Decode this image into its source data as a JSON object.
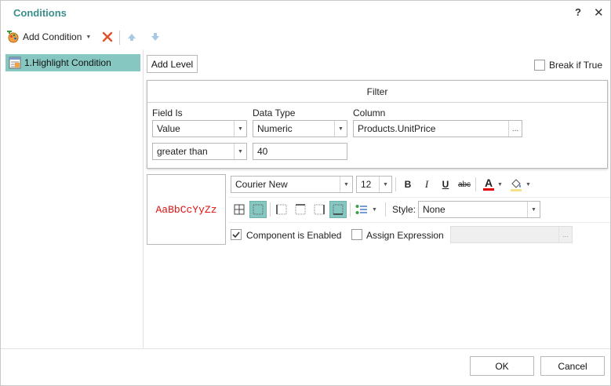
{
  "dialog": {
    "title": "Conditions",
    "help_label": "?",
    "close_label": "✕"
  },
  "toolbar": {
    "add_condition_label": "Add Condition"
  },
  "conditions": [
    {
      "label": "1.Highlight Condition"
    }
  ],
  "panel": {
    "add_level_label": "Add Level",
    "break_if_true_label": "Break if True",
    "break_if_true_checked": false
  },
  "filter": {
    "header": "Filter",
    "field_is_label": "Field Is",
    "data_type_label": "Data Type",
    "column_label": "Column",
    "field_is_value": "Value",
    "data_type_value": "Numeric",
    "column_value": "Products.UnitPrice",
    "browse_label": "...",
    "operator_value": "greater than",
    "operand_value": "40"
  },
  "format": {
    "preview_text": "AaBbCcYyZz",
    "preview_color": "#d11111",
    "font_name": "Courier New",
    "font_size": "12",
    "bold_label": "B",
    "italic_label": "I",
    "underline_label": "U",
    "strike_label": "abc",
    "font_color_label": "A",
    "font_color": "#e00000",
    "style_label": "Style:",
    "style_value": "None",
    "component_enabled_label": "Component is Enabled",
    "component_enabled_checked": true,
    "assign_expression_label": "Assign Expression",
    "assign_expression_checked": false,
    "expression_browse_label": "..."
  },
  "footer": {
    "ok_label": "OK",
    "cancel_label": "Cancel"
  },
  "colors": {
    "accent": "#86c7c1",
    "title": "#3a8f8a"
  }
}
